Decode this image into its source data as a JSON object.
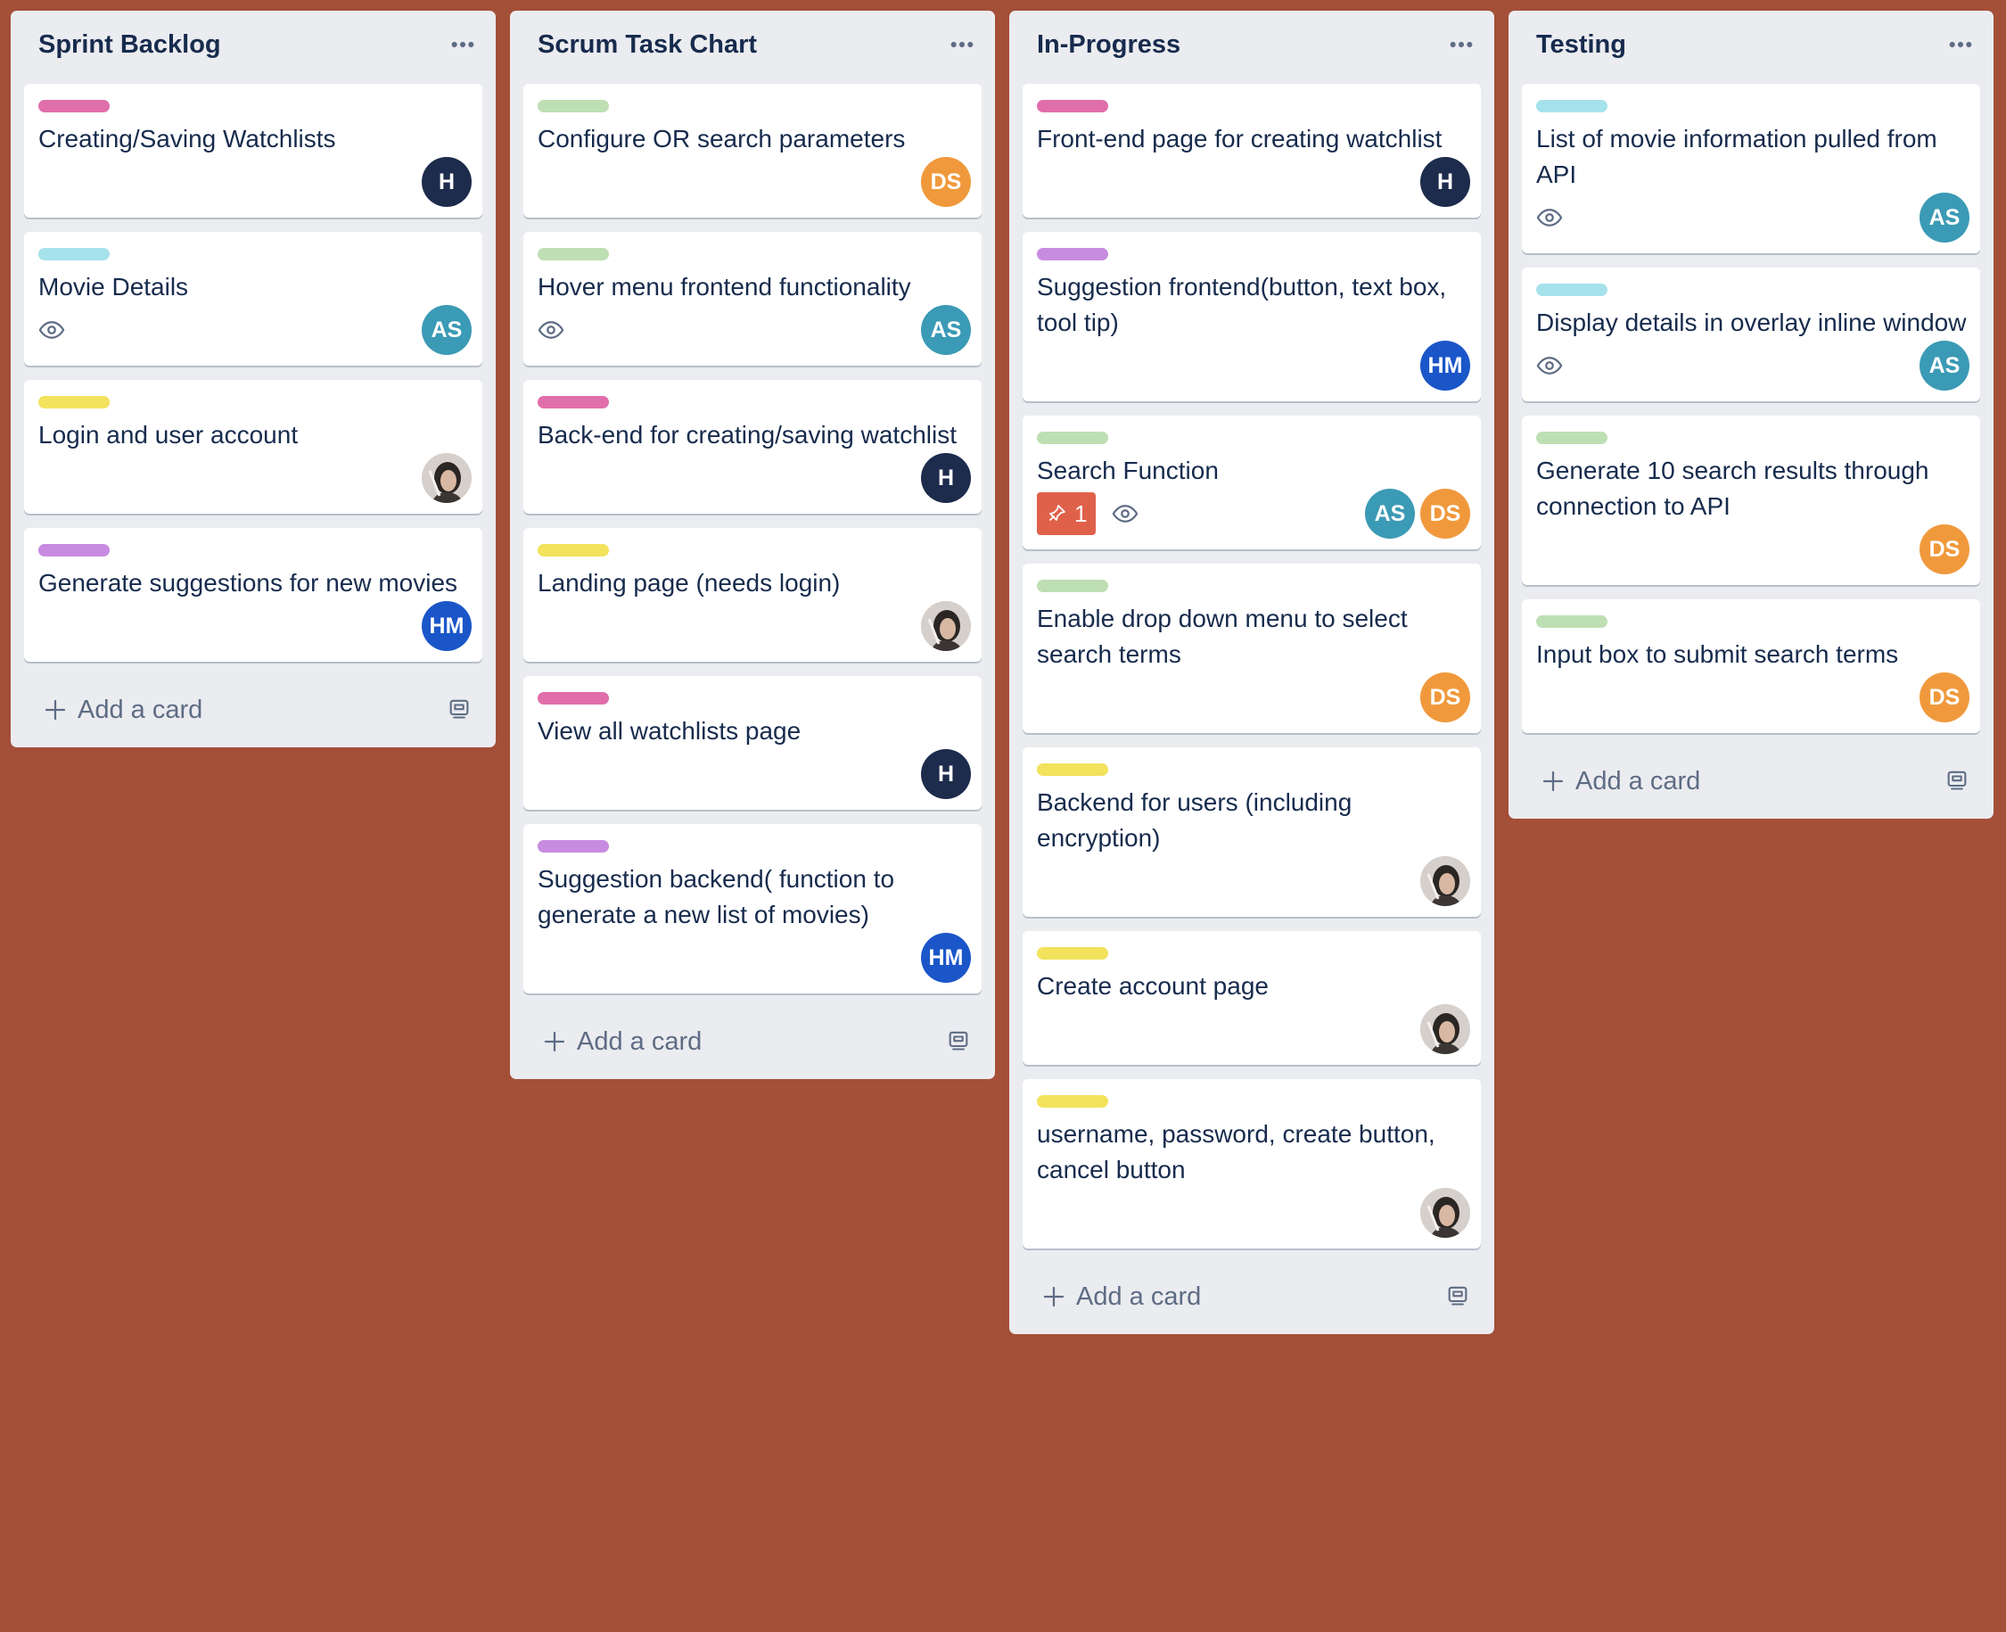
{
  "colors": {
    "board_background": "#a44f38",
    "list_background": "#ebecf0",
    "label_pink": "#e06eaa",
    "label_sky": "#a6e2ec",
    "label_yellow": "#f2e25c",
    "label_purple": "#c78ce0",
    "label_green": "#bedfb3",
    "avatar_H": "#1d2b4c",
    "avatar_AS": "#3b9ab5",
    "avatar_DS": "#f0993c",
    "avatar_HM": "#1b56c9"
  },
  "lists": [
    {
      "title": "Sprint Backlog",
      "add_label": "Add a card",
      "cards": [
        {
          "label": "pink",
          "title": "Creating/Saving Watchlists",
          "watch": false,
          "avatars": [
            {
              "initials": "H",
              "color": "H"
            }
          ]
        },
        {
          "label": "sky",
          "title": "Movie Details",
          "watch": true,
          "avatars": [
            {
              "initials": "AS",
              "color": "AS"
            }
          ]
        },
        {
          "label": "yellow",
          "title": "Login and user account",
          "watch": false,
          "avatars": [
            {
              "initials": "",
              "color": "photo"
            }
          ]
        },
        {
          "label": "purple",
          "title": "Generate suggestions for new movies",
          "watch": false,
          "avatars": [
            {
              "initials": "HM",
              "color": "HM"
            }
          ]
        }
      ]
    },
    {
      "title": "Scrum Task Chart",
      "add_label": "Add a card",
      "cards": [
        {
          "label": "green",
          "title": "Configure OR search parameters",
          "watch": false,
          "avatars": [
            {
              "initials": "DS",
              "color": "DS"
            }
          ]
        },
        {
          "label": "green",
          "title": "Hover menu frontend functionality",
          "watch": true,
          "avatars": [
            {
              "initials": "AS",
              "color": "AS"
            }
          ]
        },
        {
          "label": "pink",
          "title": "Back-end for creating/saving watchlist",
          "watch": false,
          "avatars": [
            {
              "initials": "H",
              "color": "H"
            }
          ]
        },
        {
          "label": "yellow",
          "title": "Landing page (needs login)",
          "watch": false,
          "avatars": [
            {
              "initials": "",
              "color": "photo"
            }
          ]
        },
        {
          "label": "pink",
          "title": "View all watchlists page",
          "watch": false,
          "avatars": [
            {
              "initials": "H",
              "color": "H"
            }
          ]
        },
        {
          "label": "purple",
          "title": "Suggestion backend( function to generate a new list of movies)",
          "watch": false,
          "avatars": [
            {
              "initials": "HM",
              "color": "HM"
            }
          ]
        }
      ]
    },
    {
      "title": "In-Progress",
      "add_label": "Add a card",
      "cards": [
        {
          "label": "pink",
          "title": "Front-end page for creating watchlist",
          "watch": false,
          "avatars": [
            {
              "initials": "H",
              "color": "H"
            }
          ]
        },
        {
          "label": "purple",
          "title": "Suggestion frontend(button, text box, tool tip)",
          "watch": false,
          "avatars": [
            {
              "initials": "HM",
              "color": "HM"
            }
          ]
        },
        {
          "label": "green",
          "title": "Search Function",
          "watch": true,
          "due_count": "1",
          "avatars": [
            {
              "initials": "AS",
              "color": "AS"
            },
            {
              "initials": "DS",
              "color": "DS"
            }
          ]
        },
        {
          "label": "green",
          "title": "Enable drop down menu to select search terms",
          "watch": false,
          "avatars": [
            {
              "initials": "DS",
              "color": "DS"
            }
          ]
        },
        {
          "label": "yellow",
          "title": "Backend for users (including encryption)",
          "watch": false,
          "avatars": [
            {
              "initials": "",
              "color": "photo"
            }
          ]
        },
        {
          "label": "yellow",
          "title": "Create account page",
          "watch": false,
          "avatars": [
            {
              "initials": "",
              "color": "photo"
            }
          ]
        },
        {
          "label": "yellow",
          "title": "username, password, create button, cancel button",
          "watch": false,
          "avatars": [
            {
              "initials": "",
              "color": "photo"
            }
          ]
        }
      ]
    },
    {
      "title": "Testing",
      "add_label": "Add a card",
      "cards": [
        {
          "label": "sky",
          "title": "List of movie information pulled from API",
          "watch": true,
          "avatars": [
            {
              "initials": "AS",
              "color": "AS"
            }
          ]
        },
        {
          "label": "sky",
          "title": "Display details in overlay inline window",
          "watch": true,
          "avatars": [
            {
              "initials": "AS",
              "color": "AS"
            }
          ]
        },
        {
          "label": "green",
          "title": "Generate 10 search results through connection to API",
          "watch": false,
          "avatars": [
            {
              "initials": "DS",
              "color": "DS"
            }
          ]
        },
        {
          "label": "green",
          "title": "Input box to submit search terms",
          "watch": false,
          "avatars": [
            {
              "initials": "DS",
              "color": "DS"
            }
          ]
        }
      ]
    }
  ]
}
